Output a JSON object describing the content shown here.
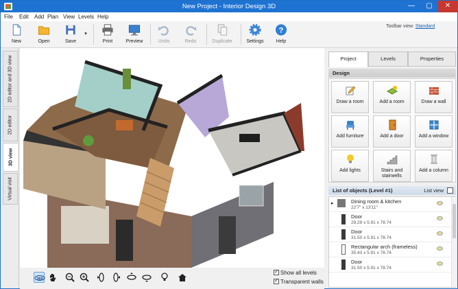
{
  "window": {
    "title": "New Project - Interior Design 3D"
  },
  "menu": [
    "File",
    "Edit",
    "Add",
    "Plan",
    "View",
    "Levels",
    "Help"
  ],
  "toolbar": {
    "items": [
      {
        "label": "New",
        "icon": "new-document-icon"
      },
      {
        "label": "Open",
        "icon": "folder-icon"
      },
      {
        "label": "Save",
        "icon": "floppy-disk-icon"
      },
      {
        "label": "Print",
        "icon": "printer-icon"
      },
      {
        "label": "Preview",
        "icon": "monitor-icon"
      },
      {
        "label": "Undo",
        "icon": "undo-icon"
      },
      {
        "label": "Redo",
        "icon": "redo-icon"
      },
      {
        "label": "Duplicate",
        "icon": "duplicate-icon"
      },
      {
        "label": "Settings",
        "icon": "gear-icon"
      },
      {
        "label": "Help",
        "icon": "help-icon"
      }
    ],
    "view_label": "Toolbar view:",
    "view_value": "Standard"
  },
  "left_tabs": [
    "2D editor and 3D view",
    "2D editor",
    "3D view",
    "Virtual visit"
  ],
  "right_tabs": [
    "Project",
    "Levels",
    "Properties"
  ],
  "design": {
    "header": "Design",
    "buttons": [
      {
        "label": "Draw a room",
        "icon": "pencil-icon"
      },
      {
        "label": "Add a room",
        "icon": "add-room-icon"
      },
      {
        "label": "Draw a wall",
        "icon": "brick-wall-icon"
      },
      {
        "label": "Add furniture",
        "icon": "chair-icon"
      },
      {
        "label": "Add a door",
        "icon": "door-icon"
      },
      {
        "label": "Add a window",
        "icon": "window-icon"
      },
      {
        "label": "Add lights",
        "icon": "light-bulb-icon"
      },
      {
        "label": "Stairs and stairwells",
        "icon": "stairs-icon"
      },
      {
        "label": "Add a column",
        "icon": "column-icon"
      }
    ]
  },
  "objects": {
    "header": "List of objects (Level #1)",
    "view_label": "List view",
    "items": [
      {
        "name": "Dining room & kitchen",
        "dims": "22'7\" x 13'11\""
      },
      {
        "name": "Door",
        "dims": "29.29 x 5.91 x 78.74"
      },
      {
        "name": "Door",
        "dims": "31.50 x 5.91 x 78.74"
      },
      {
        "name": "Rectangular arch (frameless)",
        "dims": "35.43 x 5.91 x 78.74"
      },
      {
        "name": "Door",
        "dims": "31.50 x 5.91 x 78.74"
      }
    ]
  },
  "bottom": {
    "buttons": [
      "360-view-icon",
      "hand-pan-icon",
      "zoom-out-icon",
      "zoom-in-icon",
      "rotate-left-icon",
      "rotate-right-icon",
      "tilt-up-icon",
      "tilt-down-icon",
      "light-bulb-icon",
      "home-icon"
    ],
    "show_all_levels": "Show all levels",
    "transparent_walls": "Transparent walls"
  },
  "colors": {
    "titlebar": "#1e73d2",
    "accent": "#1a5fb4"
  }
}
